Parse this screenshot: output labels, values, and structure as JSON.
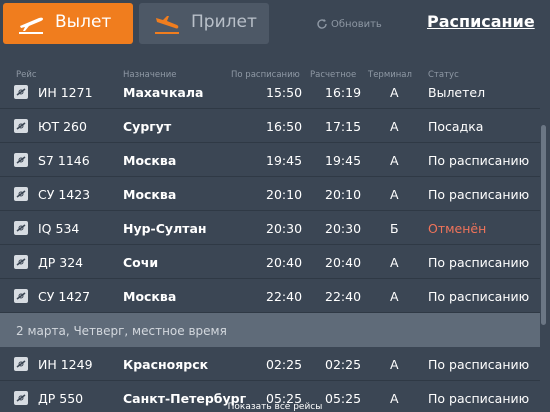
{
  "tabs": {
    "departures": "Вылет",
    "arrivals": "Прилет"
  },
  "refresh_label": "Обновить",
  "schedule_link": "Расписание",
  "columns": {
    "flight": "Рейс",
    "destination": "Назначение",
    "scheduled": "По расписанию",
    "estimated": "Расчетное",
    "terminal": "Терминал",
    "status": "Статус"
  },
  "colors": {
    "accent": "#f07d1e",
    "cancelled": "#f0735a",
    "background": "#3b4654"
  },
  "flights": [
    {
      "icon": "airline-logo-icon",
      "flight": "ИН 1271",
      "destination": "Махачкала",
      "scheduled": "15:50",
      "estimated": "16:19",
      "terminal": "А",
      "status": "Вылетел"
    },
    {
      "icon": "airline-logo-icon",
      "flight": "ЮТ 260",
      "destination": "Сургут",
      "scheduled": "16:50",
      "estimated": "17:15",
      "terminal": "А",
      "status": "Посадка"
    },
    {
      "icon": "airline-logo-icon",
      "flight": "S7 1146",
      "destination": "Москва",
      "scheduled": "19:45",
      "estimated": "19:45",
      "terminal": "А",
      "status": "По расписанию"
    },
    {
      "icon": "airline-logo-icon",
      "flight": "СУ 1423",
      "destination": "Москва",
      "scheduled": "20:10",
      "estimated": "20:10",
      "terminal": "А",
      "status": "По расписанию"
    },
    {
      "icon": "airline-logo-icon",
      "flight": "IQ 534",
      "destination": "Нур-Султан",
      "scheduled": "20:30",
      "estimated": "20:30",
      "terminal": "Б",
      "status": "Отменён"
    },
    {
      "icon": "airline-logo-icon",
      "flight": "ДР 324",
      "destination": "Сочи",
      "scheduled": "20:40",
      "estimated": "20:40",
      "terminal": "А",
      "status": "По расписанию"
    },
    {
      "icon": "airline-logo-icon",
      "flight": "СУ 1427",
      "destination": "Москва",
      "scheduled": "22:40",
      "estimated": "22:40",
      "terminal": "А",
      "status": "По расписанию"
    }
  ],
  "date_separator": "2 марта, Четверг, местное время",
  "flights_next_day": [
    {
      "icon": "airline-logo-icon",
      "flight": "ИН 1249",
      "destination": "Красноярск",
      "scheduled": "02:25",
      "estimated": "02:25",
      "terminal": "А",
      "status": "По расписанию"
    },
    {
      "icon": "airline-logo-icon",
      "flight": "ДР 550",
      "destination": "Санкт-Петербург",
      "scheduled": "05:25",
      "estimated": "05:25",
      "terminal": "А",
      "status": "По расписанию"
    }
  ],
  "show_all": "Показать все рейсы"
}
